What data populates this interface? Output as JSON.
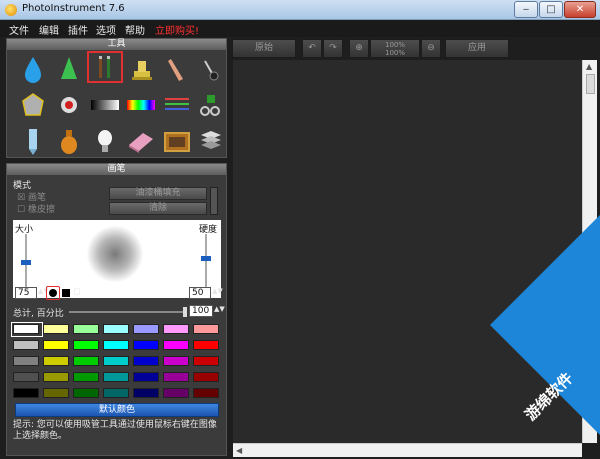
{
  "window": {
    "title": "PhotoInstrument 7.6"
  },
  "menu": {
    "items": [
      "文件",
      "编辑",
      "插件",
      "选项",
      "帮助"
    ],
    "buy": "立即购买!"
  },
  "tools_panel": {
    "header": "工具"
  },
  "brush_panel": {
    "header": "画笔",
    "mode_label": "模式",
    "brush_option": "画笔",
    "eraser_option": "橡皮擦",
    "fill_button": "油漆桶填充",
    "clear_button": "清除",
    "size_label": "大小",
    "hardness_label": "硬度",
    "size_value": "75",
    "hardness_value": "50",
    "opacity_label": "总计, 百分比",
    "opacity_value": "100",
    "default_colors_button": "默认颜色",
    "hint": "提示: 您可以使用吸管工具通过使用鼠标右键在图像上选择颜色。"
  },
  "toolbar": {
    "original": "原始",
    "zoom_display": "100%",
    "zoom_display2": "100%",
    "apply": "应用"
  },
  "palette": [
    [
      "#ffffff",
      "#ffff99",
      "#99ff99",
      "#99ffff",
      "#9999ff",
      "#ff99ff",
      "#ff9999"
    ],
    [
      "#c0c0c0",
      "#ffff00",
      "#00ff00",
      "#00ffff",
      "#0000ff",
      "#ff00ff",
      "#ff0000"
    ],
    [
      "#808080",
      "#cccc00",
      "#00cc00",
      "#00cccc",
      "#0000cc",
      "#cc00cc",
      "#cc0000"
    ],
    [
      "#505050",
      "#999900",
      "#009900",
      "#009999",
      "#000099",
      "#990099",
      "#990000"
    ],
    [
      "#000000",
      "#666600",
      "#006600",
      "#006666",
      "#000066",
      "#660066",
      "#660000"
    ]
  ],
  "watermark": {
    "text": "游绵软件"
  }
}
